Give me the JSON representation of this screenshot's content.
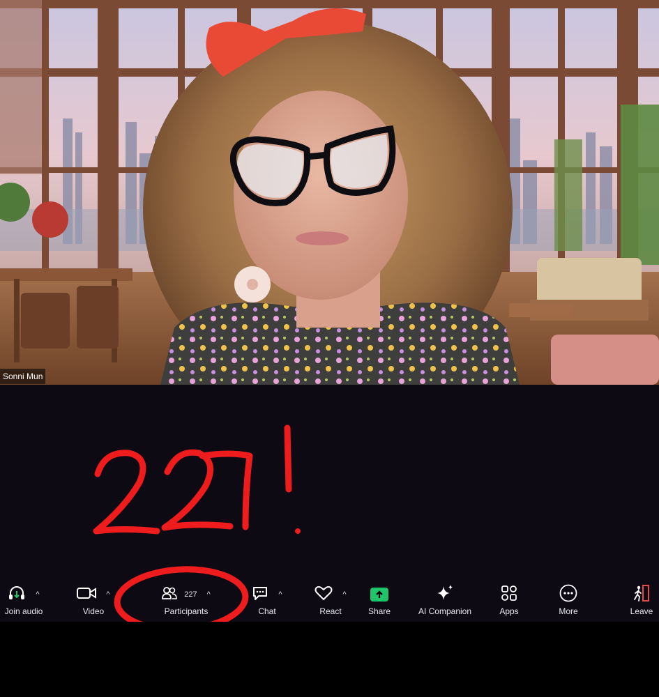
{
  "meeting": {
    "participant_name": "Sonni Mun"
  },
  "annotation": {
    "text": "227!",
    "color": "#ee1c1c"
  },
  "toolbar": {
    "items": [
      {
        "label": "Join audio",
        "icon": "headphones-icon",
        "caret": "^"
      },
      {
        "label": "Video",
        "icon": "video-camera-icon",
        "caret": "^"
      },
      {
        "label": "Participants",
        "icon": "participants-icon",
        "count": "227",
        "caret": "^"
      },
      {
        "label": "Chat",
        "icon": "chat-bubble-icon",
        "caret": "^"
      },
      {
        "label": "React",
        "icon": "heart-icon",
        "caret": "^"
      },
      {
        "label": "Share",
        "icon": "share-arrow-icon"
      },
      {
        "label": "AI Companion",
        "icon": "sparkle-icon"
      },
      {
        "label": "Apps",
        "icon": "apps-icon"
      },
      {
        "label": "More",
        "icon": "more-dots-icon"
      },
      {
        "label": "Leave",
        "icon": "leave-door-icon"
      }
    ],
    "share_color": "#21c46b",
    "leave_color": "#e5484d"
  }
}
